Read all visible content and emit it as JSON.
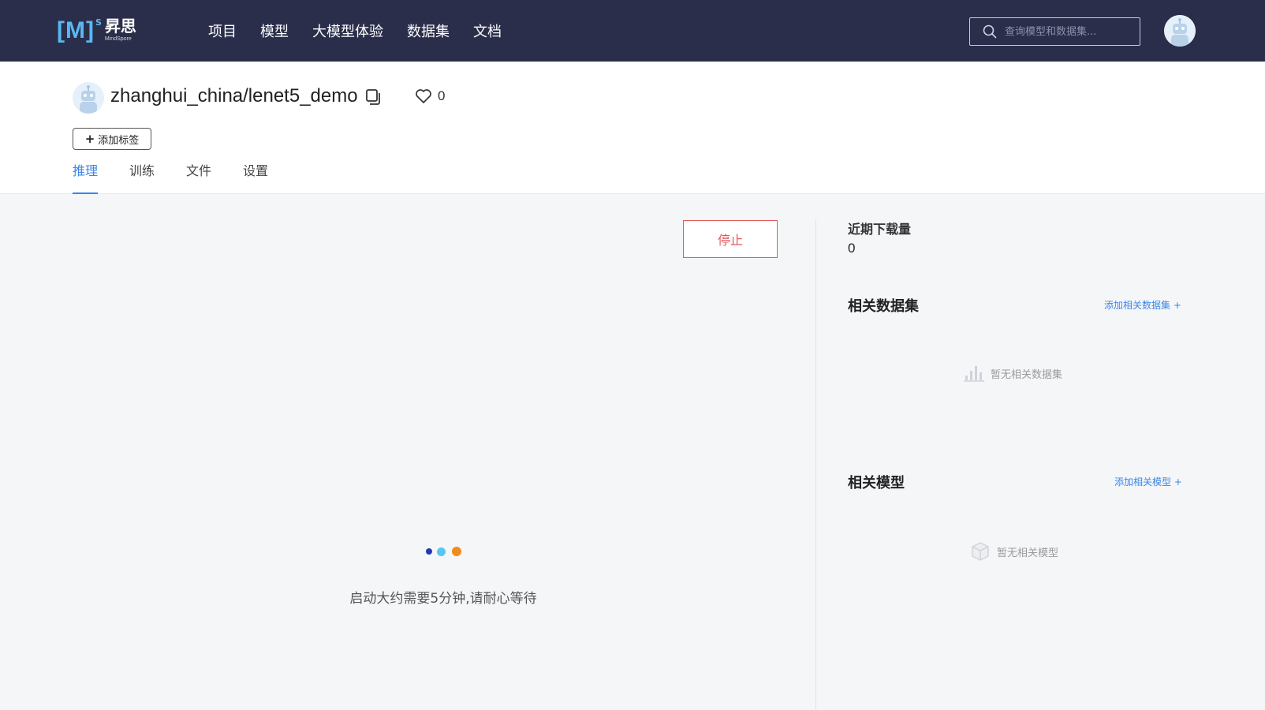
{
  "logo": {
    "mark": "[M]",
    "superscript": "S",
    "name_cn": "昇思",
    "name_en": "MindSpore"
  },
  "nav": {
    "items": [
      "项目",
      "模型",
      "大模型体验",
      "数据集",
      "文档"
    ]
  },
  "search": {
    "placeholder": "查询模型和数据集..."
  },
  "repo": {
    "title": "zhanghui_china/lenet5_demo",
    "likes": "0",
    "add_tag_label": "添加标签"
  },
  "tabs": [
    "推理",
    "训练",
    "文件",
    "设置"
  ],
  "main": {
    "stop_label": "停止",
    "wait_message": "启动大约需要5分钟,请耐心等待"
  },
  "sidebar": {
    "downloads_label": "近期下载量",
    "downloads_value": "0",
    "datasets": {
      "title": "相关数据集",
      "add_label": "添加相关数据集 +",
      "empty_text": "暂无相关数据集"
    },
    "models": {
      "title": "相关模型",
      "add_label": "添加相关模型 +",
      "empty_text": "暂无相关模型"
    }
  },
  "colors": {
    "nav_bg": "#2a2e4a",
    "accent": "#3a86e8",
    "stop": "#e35a5a",
    "loader": [
      "#1e3bb3",
      "#55c8f0",
      "#f28b1e"
    ]
  }
}
